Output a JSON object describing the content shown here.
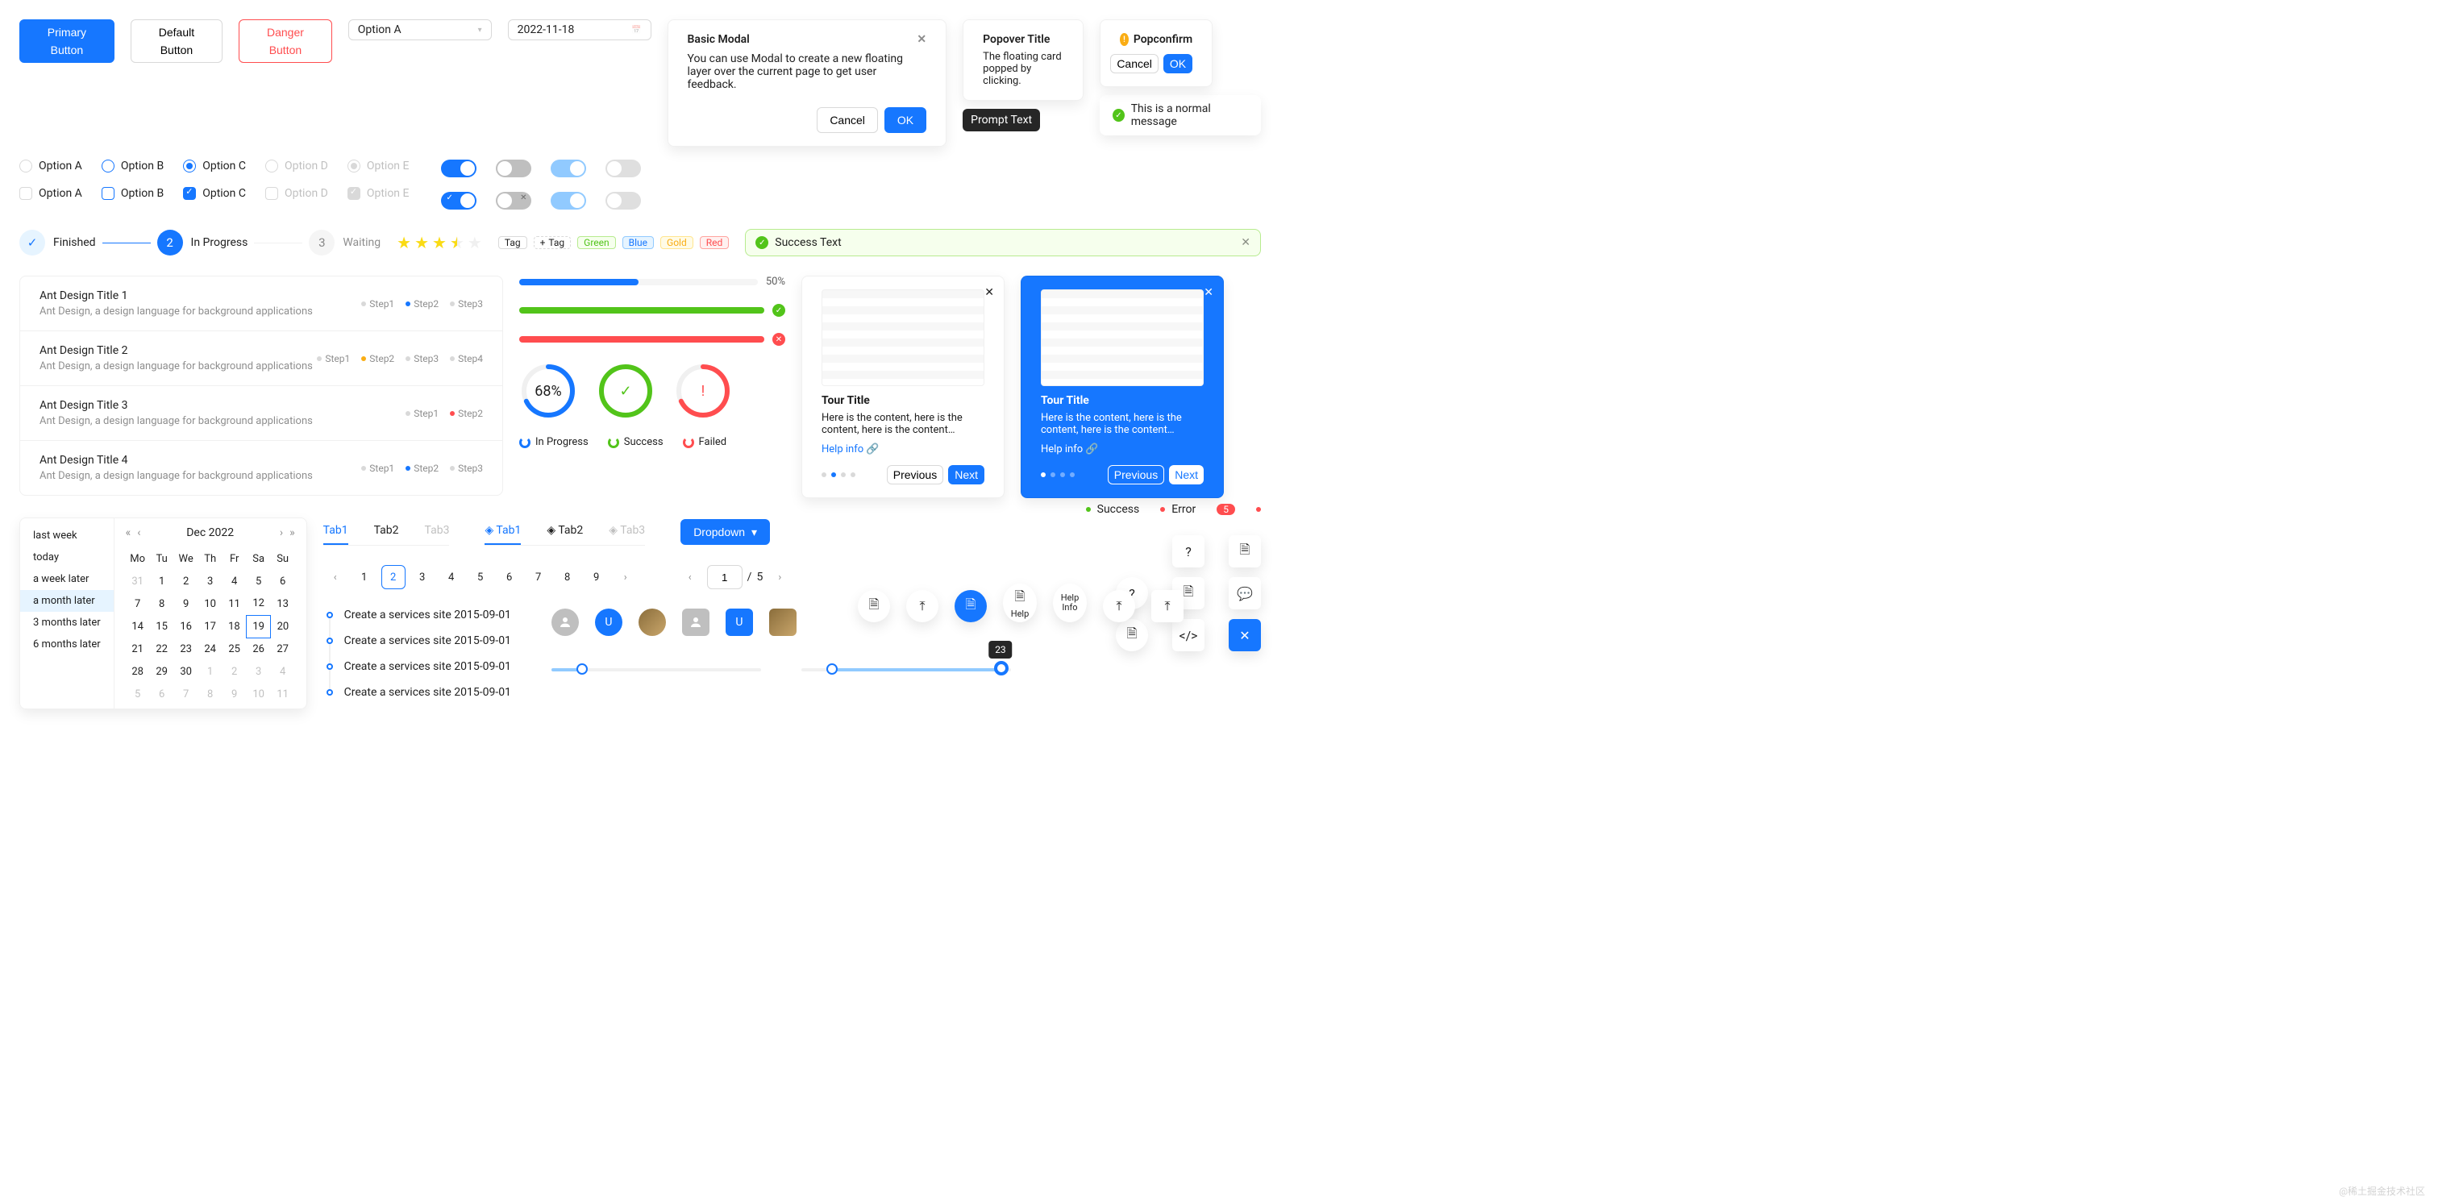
{
  "buttons": {
    "primary": "Primary Button",
    "default": "Default Button",
    "danger": "Danger Button"
  },
  "select": {
    "value": "Option A"
  },
  "date": {
    "value": "2022-11-18"
  },
  "radios": {
    "a": "Option A",
    "b": "Option B",
    "c": "Option C",
    "d": "Option D",
    "e": "Option E"
  },
  "modal": {
    "title": "Basic Modal",
    "body": "You can use Modal to create a new floating layer over the current page to get user feedback.",
    "cancel": "Cancel",
    "ok": "OK"
  },
  "popover": {
    "title": "Popover Title",
    "body": "The floating card popped by clicking."
  },
  "popconfirm": {
    "title": "Popconfirm",
    "cancel": "Cancel",
    "ok": "OK"
  },
  "tooltip": "Prompt Text",
  "message": "This is a normal message",
  "steps": {
    "finished": "Finished",
    "in_progress": "In Progress",
    "waiting": "Waiting",
    "n2": "2",
    "n3": "3"
  },
  "tags": {
    "tag": "Tag",
    "add": "Tag",
    "green": "Green",
    "blue": "Blue",
    "gold": "Gold",
    "red": "Red"
  },
  "alert": "Success Text",
  "list": {
    "subtitle": "Ant Design, a design language for background applications",
    "items": [
      {
        "title": "Ant Design Title 1",
        "steps": [
          "Step1",
          "Step2",
          "Step3"
        ],
        "active": 1,
        "colors": [
          "blue",
          "blue",
          "blue"
        ]
      },
      {
        "title": "Ant Design Title 2",
        "steps": [
          "Step1",
          "Step2",
          "Step3",
          "Step4"
        ],
        "active": 1,
        "colors": [
          "gold",
          "gold",
          "gold",
          "gold"
        ]
      },
      {
        "title": "Ant Design Title 3",
        "steps": [
          "Step1",
          "Step2"
        ],
        "active": 1,
        "colors": [
          "red",
          "red"
        ]
      },
      {
        "title": "Ant Design Title 4",
        "steps": [
          "Step1",
          "Step2",
          "Step3"
        ],
        "active": 1,
        "colors": [
          "blue",
          "blue",
          "blue"
        ]
      }
    ]
  },
  "progress": {
    "p1": 50,
    "p1_label": "50%",
    "p2": 100,
    "p3": 100,
    "c1": 68,
    "c1_label": "68%",
    "legend": {
      "in_progress": "In Progress",
      "success": "Success",
      "failed": "Failed"
    }
  },
  "tour": {
    "title": "Tour Title",
    "body": "Here is the content, here is the content, here is the content…",
    "help": "Help info",
    "prev": "Previous",
    "next": "Next"
  },
  "calendar": {
    "ranges": [
      "last week",
      "today",
      "a week later",
      "a month later",
      "3 months later",
      "6 months later"
    ],
    "selectedRange": 3,
    "title": "Dec   2022",
    "dow": [
      "Mo",
      "Tu",
      "We",
      "Th",
      "Fr",
      "Sa",
      "Su"
    ],
    "weeks": [
      [
        "31",
        "1",
        "2",
        "3",
        "4",
        "5",
        "6"
      ],
      [
        "7",
        "8",
        "9",
        "10",
        "11",
        "12",
        "13"
      ],
      [
        "14",
        "15",
        "16",
        "17",
        "18",
        "19",
        "20"
      ],
      [
        "21",
        "22",
        "23",
        "24",
        "25",
        "26",
        "27"
      ],
      [
        "28",
        "29",
        "30",
        "1",
        "2",
        "3",
        "4"
      ],
      [
        "5",
        "6",
        "7",
        "8",
        "9",
        "10",
        "11"
      ]
    ],
    "todayRow": 2,
    "todayCol": 5
  },
  "tabs": {
    "items": [
      "Tab1",
      "Tab2",
      "Tab3"
    ],
    "active": 0,
    "disabled": 2
  },
  "tabs2": {
    "items": [
      "Tab1",
      "Tab2",
      "Tab3"
    ],
    "active": 0,
    "disabled": 2
  },
  "dropdown": "Dropdown",
  "pagination": {
    "pages": [
      "1",
      "2",
      "3",
      "4",
      "5",
      "6",
      "7",
      "8",
      "9"
    ],
    "active": 1
  },
  "simplepager": {
    "cur": "1",
    "sep": "/",
    "total": "5"
  },
  "timeline": [
    "Create a services site 2015-09-01",
    "Create a services site 2015-09-01",
    "Create a services site 2015-09-01",
    "Create a services site 2015-09-01"
  ],
  "avatars": {
    "letter": "U"
  },
  "slider2_tip": "23",
  "badges": {
    "success": "Success",
    "error": "Error",
    "count": "5"
  },
  "float": {
    "help": "Help",
    "help_info": "Help\nInfo"
  },
  "watermark": "@稀土掘金技术社区"
}
